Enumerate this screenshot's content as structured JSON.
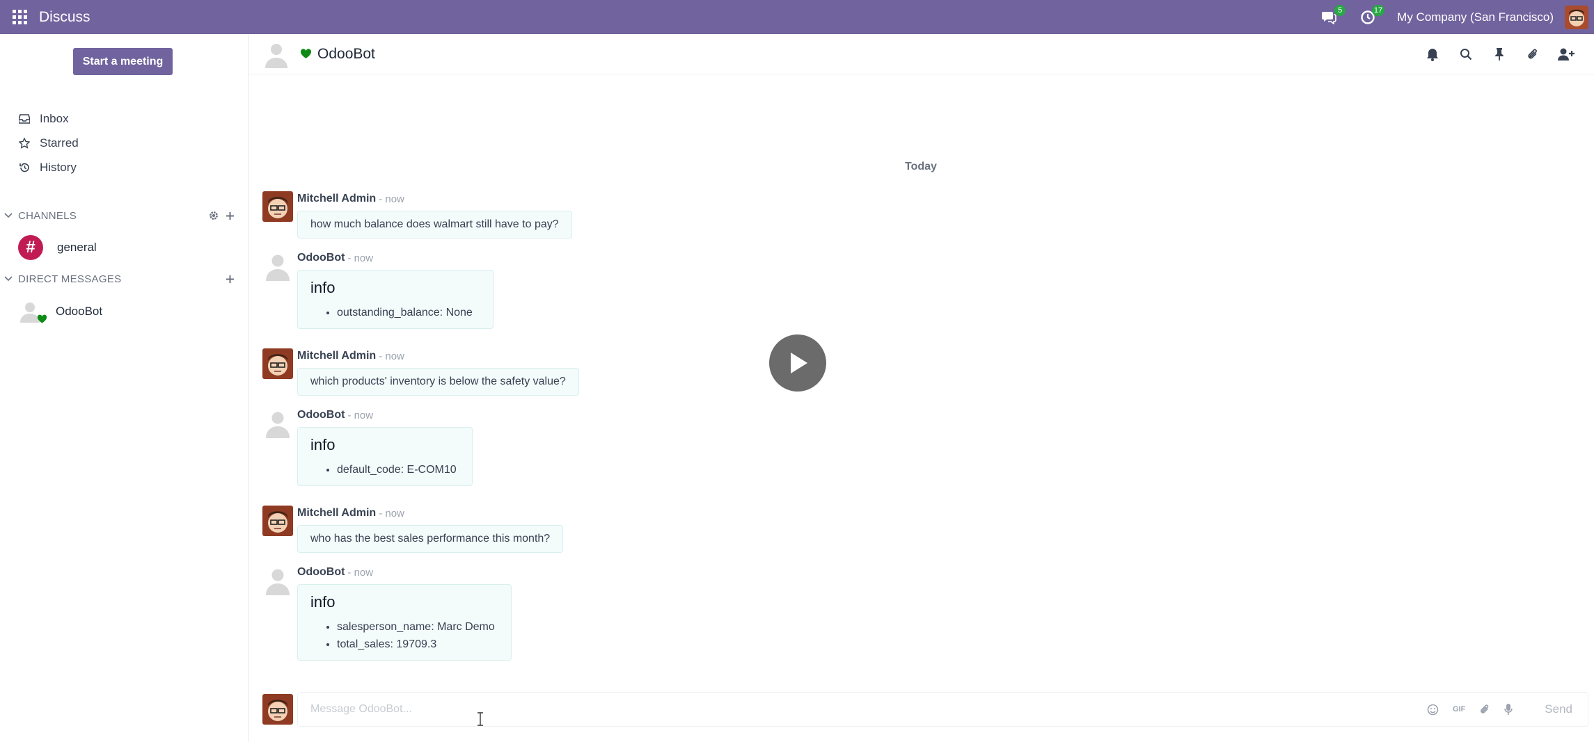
{
  "navbar": {
    "app_title": "Discuss",
    "messages_badge": "5",
    "activities_badge": "17",
    "company": "My Company (San Francisco)",
    "bg_color": "#71639e"
  },
  "sidebar": {
    "meeting_button": "Start a meeting",
    "nav_items": [
      {
        "label": "Inbox",
        "icon": "inbox-icon"
      },
      {
        "label": "Starred",
        "icon": "star-icon"
      },
      {
        "label": "History",
        "icon": "history-icon"
      }
    ],
    "channels_header": "CHANNELS",
    "channels": [
      {
        "label": "general",
        "icon": "#"
      }
    ],
    "dm_header": "DIRECT MESSAGES",
    "direct_messages": [
      {
        "label": "OdooBot"
      }
    ]
  },
  "thread": {
    "name": "OdooBot",
    "day_separator": "Today",
    "messages": [
      {
        "author": "Mitchell Admin",
        "time": "- now",
        "text": "how much balance does walmart still have to pay?"
      },
      {
        "author": "OdooBot",
        "time": "- now",
        "heading": "info",
        "items": [
          "outstanding_balance: None"
        ]
      },
      {
        "author": "Mitchell Admin",
        "time": "- now",
        "text": "which products' inventory is below the safety value?"
      },
      {
        "author": "OdooBot",
        "time": "- now",
        "heading": "info",
        "items": [
          "default_code: E-COM10"
        ]
      },
      {
        "author": "Mitchell Admin",
        "time": "- now",
        "text": "who has the best sales performance this month?"
      },
      {
        "author": "OdooBot",
        "time": "- now",
        "heading": "info",
        "items": [
          "salesperson_name: Marc Demo",
          "total_sales: 19709.3"
        ]
      }
    ]
  },
  "composer": {
    "placeholder": "Message OdooBot...",
    "gif_label": "GIF",
    "send_label": "Send"
  }
}
